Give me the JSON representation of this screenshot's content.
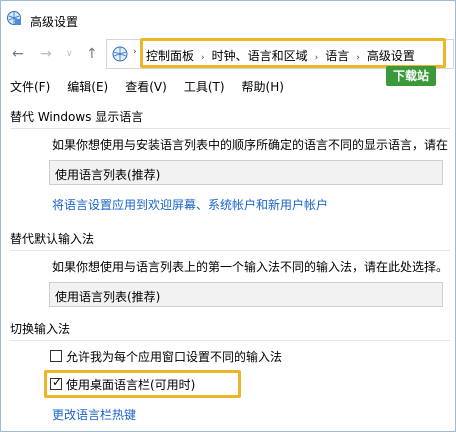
{
  "window": {
    "title": "高级设置"
  },
  "nav": {
    "back": "←",
    "forward": "→",
    "dropdown": "∨",
    "up": "↑"
  },
  "breadcrumb": {
    "items": [
      "控制面板",
      "时钟、语言和区域",
      "语言",
      "高级设置"
    ],
    "separator": "›"
  },
  "watermark": {
    "text": "下载站"
  },
  "menu": {
    "items": [
      "文件(F)",
      "编辑(E)",
      "查看(V)",
      "工具(T)",
      "帮助(H)"
    ]
  },
  "section_display": {
    "title": "替代 Windows 显示语言",
    "desc": "如果你想使用与安装语言列表中的顺序所确定的语言不同的显示语言，请在",
    "select_value": "使用语言列表(推荐)",
    "link": "将语言设置应用到欢迎屏幕、系统帐户和新用户帐户"
  },
  "section_input": {
    "title": "替代默认输入法",
    "desc": "如果你想使用与语言列表上的第一个输入法不同的输入法，请在此处选择。",
    "select_value": "使用语言列表(推荐)"
  },
  "section_switch": {
    "title": "切换输入法",
    "option1": {
      "label": "允许我为每个应用窗口设置不同的输入法",
      "checked": false
    },
    "option2": {
      "label": "使用桌面语言栏(可用时)",
      "checked": true,
      "mark": "✓"
    },
    "link": "更改语言栏热键"
  },
  "colors": {
    "link": "#1a64c8",
    "highlight": "#f0b428",
    "watermark": "#3a9a3a"
  }
}
